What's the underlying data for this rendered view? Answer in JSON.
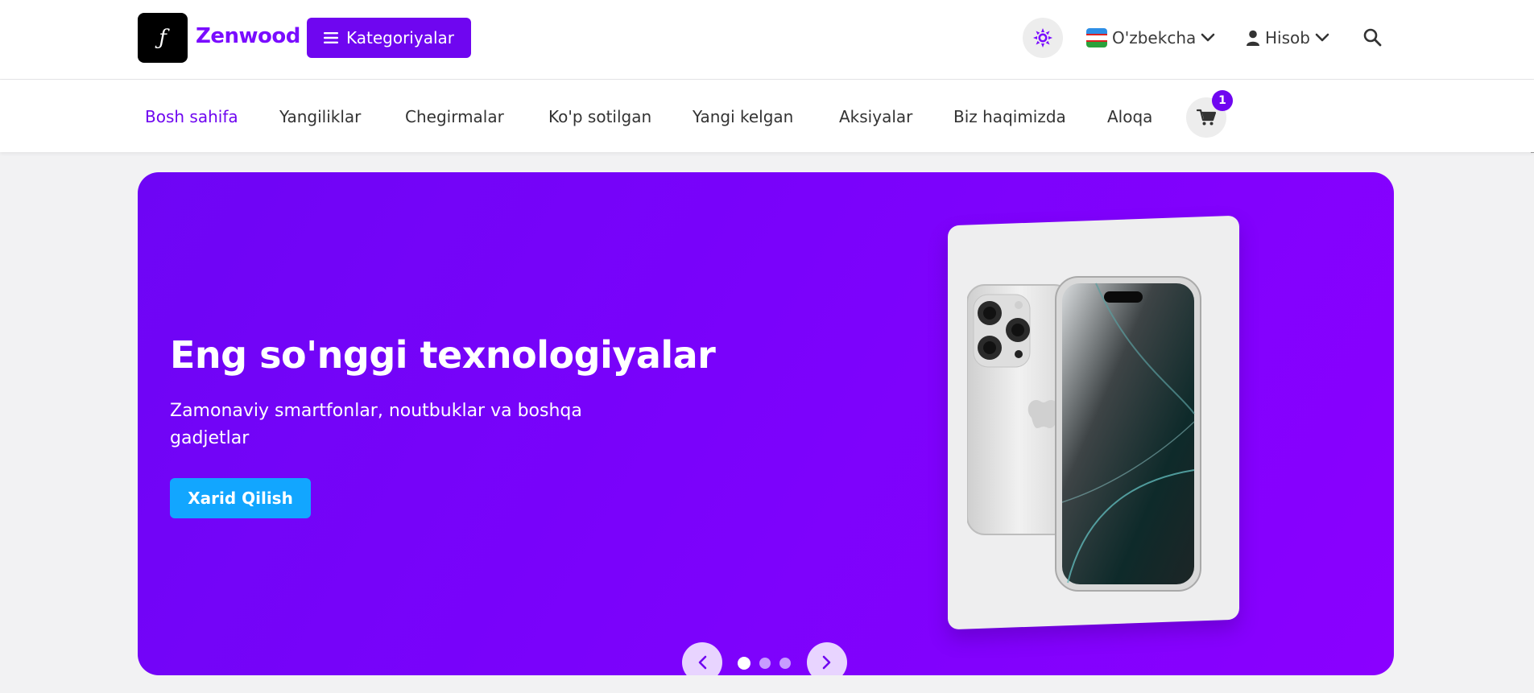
{
  "header": {
    "brand": "Zenwood",
    "logo_glyph": "ƒ",
    "categories_label": "Kategoriyalar",
    "language_label": "O'zbekcha",
    "account_label": "Hisob"
  },
  "nav": {
    "items": [
      {
        "label": "Bosh sahifa",
        "active": true
      },
      {
        "label": "Yangiliklar"
      },
      {
        "label": "Chegirmalar"
      },
      {
        "label": "Ko'p sotilgan"
      },
      {
        "label": "Yangi kelgan"
      },
      {
        "label": "Aksiyalar"
      },
      {
        "label": "Biz haqimizda"
      },
      {
        "label": "Aloqa"
      }
    ],
    "cart_count": "1"
  },
  "hero": {
    "title": "Eng so'nggi texnologiyalar",
    "subtitle": "Zamonaviy smartfonlar, noutbuklar va boshqa gadjetlar",
    "cta_label": "Xarid Qilish",
    "active_slide": 1,
    "slide_count": 3
  },
  "colors": {
    "accent": "#6f06f0",
    "hero_gradient_start": "#6e05f5",
    "hero_gradient_end": "#8a00ff",
    "cta": "#12a6ff"
  },
  "icons": [
    "menu-icon",
    "sun-icon",
    "uz-flag-icon",
    "chevron-down-icon",
    "user-icon",
    "search-icon",
    "cart-icon",
    "chevron-left-icon",
    "chevron-right-icon"
  ]
}
